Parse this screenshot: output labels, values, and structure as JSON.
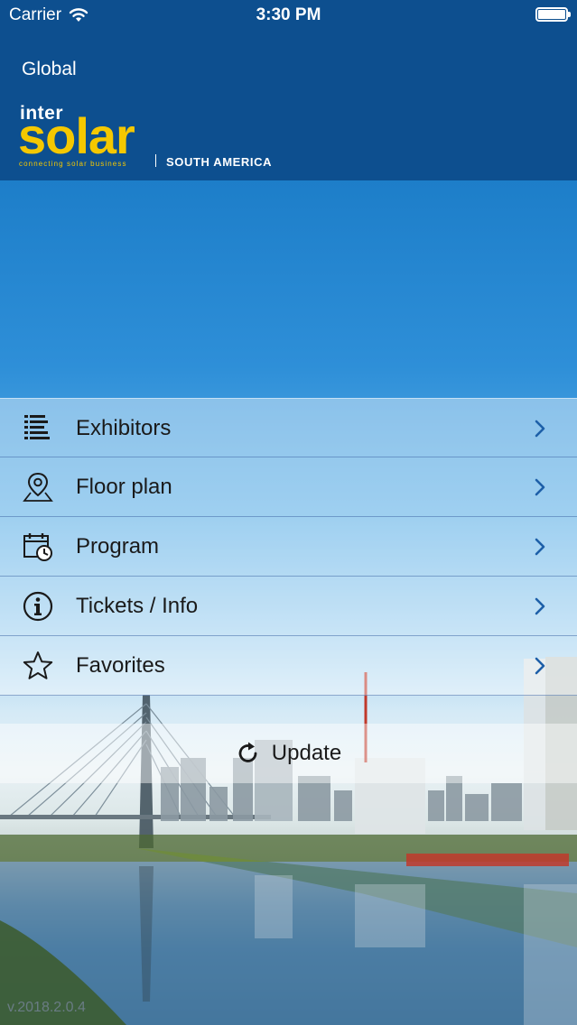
{
  "status_bar": {
    "carrier": "Carrier",
    "time": "3:30 PM",
    "icons": [
      "wifi-icon",
      "battery-icon"
    ]
  },
  "header": {
    "back_label": "Global",
    "logo": {
      "inter": "inter",
      "solar": "solar",
      "tagline": "connecting solar business",
      "region": "SOUTH AMERICA"
    },
    "colors": {
      "background": "#0d4f8f",
      "logo_accent": "#f5c800"
    }
  },
  "menu": {
    "items": [
      {
        "label": "Exhibitors",
        "icon": "list-icon"
      },
      {
        "label": "Floor plan",
        "icon": "map-pin-icon"
      },
      {
        "label": "Program",
        "icon": "calendar-clock-icon"
      },
      {
        "label": "Tickets / Info",
        "icon": "info-icon"
      },
      {
        "label": "Favorites",
        "icon": "star-icon"
      }
    ],
    "chevron_color": "#1d5fa8"
  },
  "update": {
    "label": "Update",
    "icon": "refresh-icon"
  },
  "footer": {
    "version": "v.2018.2.0.4"
  }
}
